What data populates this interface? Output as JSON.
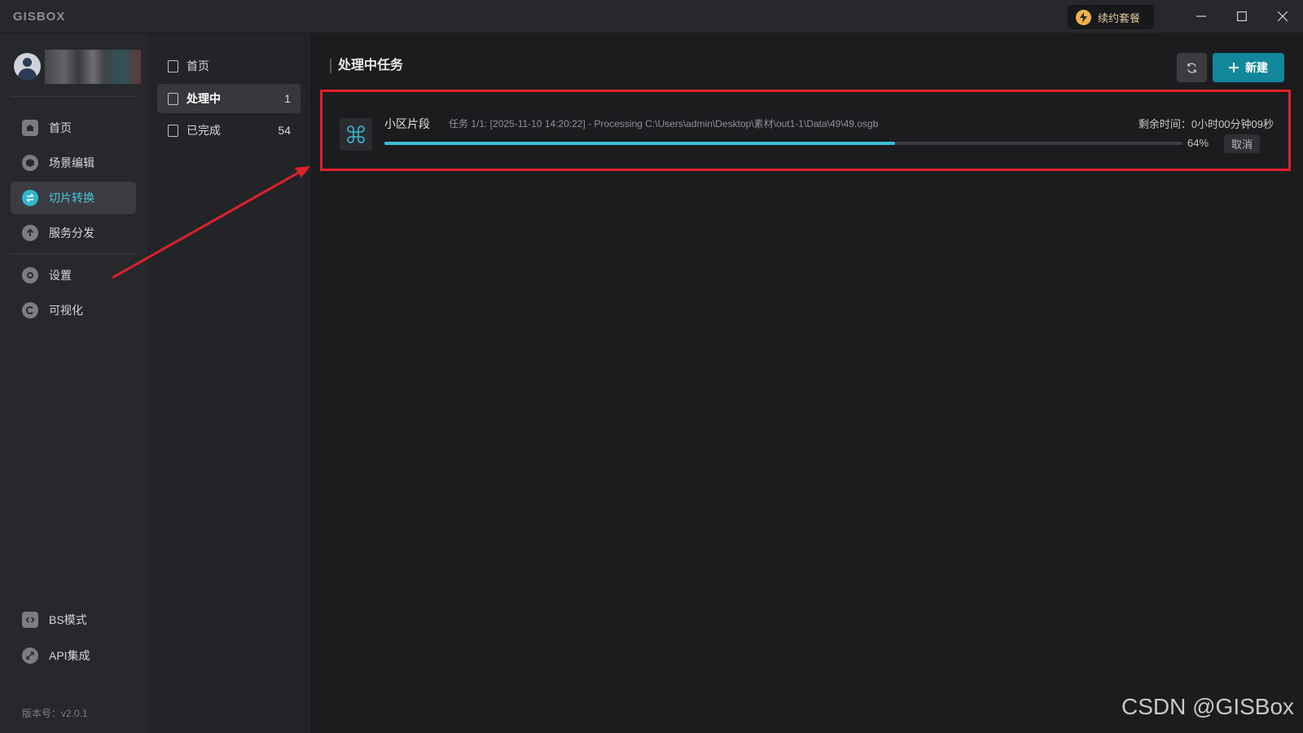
{
  "app": {
    "logo": "GISBOX"
  },
  "titlebar": {
    "renew_label": "续约套餐"
  },
  "sidebar": {
    "items": [
      {
        "label": "首页",
        "icon": "home-icon"
      },
      {
        "label": "场景编辑",
        "icon": "cube-icon"
      },
      {
        "label": "切片转换",
        "icon": "swap-icon",
        "active": true
      },
      {
        "label": "服务分发",
        "icon": "upload-icon"
      },
      {
        "label": "设置",
        "icon": "gear-icon"
      },
      {
        "label": "可视化",
        "icon": "visual-icon"
      }
    ],
    "bottom_items": [
      {
        "label": "BS模式",
        "icon": "code-icon"
      },
      {
        "label": "API集成",
        "icon": "link-icon"
      }
    ],
    "version": "版本号：v2.0.1"
  },
  "subnav": {
    "items": [
      {
        "label": "首页",
        "count": ""
      },
      {
        "label": "处理中",
        "count": "1",
        "active": true
      },
      {
        "label": "已完成",
        "count": "54"
      }
    ]
  },
  "main": {
    "title": "处理中任务",
    "new_label": "新建",
    "task": {
      "name": "小区片段",
      "description": "任务 1/1: [2025-11-10 14:20:22] - Processing C:\\Users\\admin\\Desktop\\素材\\out1-1\\Data\\49\\49.osgb",
      "remaining": "剩余时间：0小时00分钟09秒",
      "percent_label": "64%",
      "progress": 0.64,
      "cancel_label": "取消"
    }
  },
  "colors": {
    "accent": "#2fb9cf",
    "primary_button": "#12869a",
    "highlight_border": "#e0202a"
  },
  "watermark": "CSDN @GISBox"
}
